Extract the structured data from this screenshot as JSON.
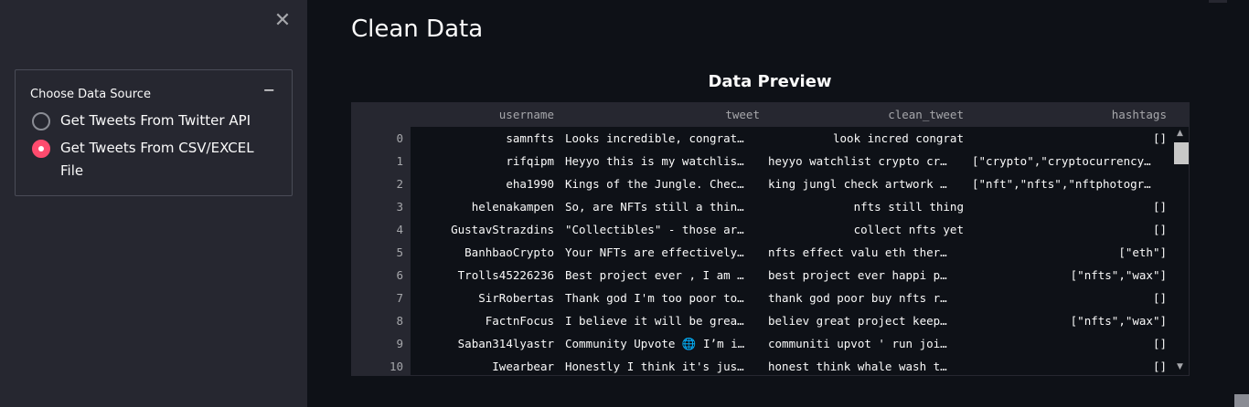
{
  "sidebar": {
    "close_icon": "close-icon",
    "expander": {
      "title": "Choose Data Source",
      "collapse_symbol": "−",
      "options": [
        {
          "label": "Get Tweets From Twitter API",
          "checked": false
        },
        {
          "label": "Get Tweets From CSV/EXCEL File",
          "checked": true
        }
      ]
    }
  },
  "main": {
    "page_title": "Clean Data",
    "section_title": "Data Preview",
    "table": {
      "columns": [
        "username",
        "tweet",
        "clean_tweet",
        "hashtags"
      ],
      "rows": [
        {
          "index": "0",
          "username": "samnfts",
          "tweet": "Looks incredible, congrat…",
          "clean_tweet": "look incred congrat",
          "hashtags": "[]"
        },
        {
          "index": "1",
          "username": "rifqipm",
          "tweet": "Heyyo this is my watchlis…",
          "clean_tweet": "heyyo watchlist crypto cr…",
          "hashtags": "[\"crypto\",\"cryptocurrency…"
        },
        {
          "index": "2",
          "username": "eha1990",
          "tweet": "Kings of the Jungle. Chec…",
          "clean_tweet": "king jungl check artwork …",
          "hashtags": "[\"nft\",\"nfts\",\"nftphotogr…"
        },
        {
          "index": "3",
          "username": "helenakampen",
          "tweet": "So, are NFTs still a thin…",
          "clean_tweet": "nfts still thing",
          "hashtags": "[]"
        },
        {
          "index": "4",
          "username": "GustavStrazdins",
          "tweet": "\"Collectibles\" - those ar…",
          "clean_tweet": "collect nfts yet",
          "hashtags": "[]"
        },
        {
          "index": "5",
          "username": "BanhbaoCrypto",
          "tweet": "Your NFTs are effectively…",
          "clean_tweet": "nfts effect valu eth ther…",
          "hashtags": "[\"eth\"]"
        },
        {
          "index": "6",
          "username": "Trolls45226236",
          "tweet": "Best project ever , I am …",
          "clean_tweet": "best project ever happi p…",
          "hashtags": "[\"nfts\",\"wax\"]"
        },
        {
          "index": "7",
          "username": "SirRobertas",
          "tweet": "Thank god I'm too poor to…",
          "clean_tweet": "thank god poor buy nfts r…",
          "hashtags": "[]"
        },
        {
          "index": "8",
          "username": "FactnFocus",
          "tweet": "I believe it will be grea…",
          "clean_tweet": "believ great project keep…",
          "hashtags": "[\"nfts\",\"wax\"]"
        },
        {
          "index": "9",
          "username": "Saban314lyastr",
          "tweet": "Community Upvote 🌐 I’m i…",
          "clean_tweet": "communiti upvot ' run joi…",
          "hashtags": "[]"
        },
        {
          "index": "10",
          "username": "Iwearbear",
          "tweet": "Honestly I think it's jus…",
          "clean_tweet": "honest think whale wash t…",
          "hashtags": "[]"
        }
      ]
    }
  },
  "colors": {
    "background": "#0e1117",
    "sidebar": "#262730",
    "accent": "#ff4b6e"
  }
}
